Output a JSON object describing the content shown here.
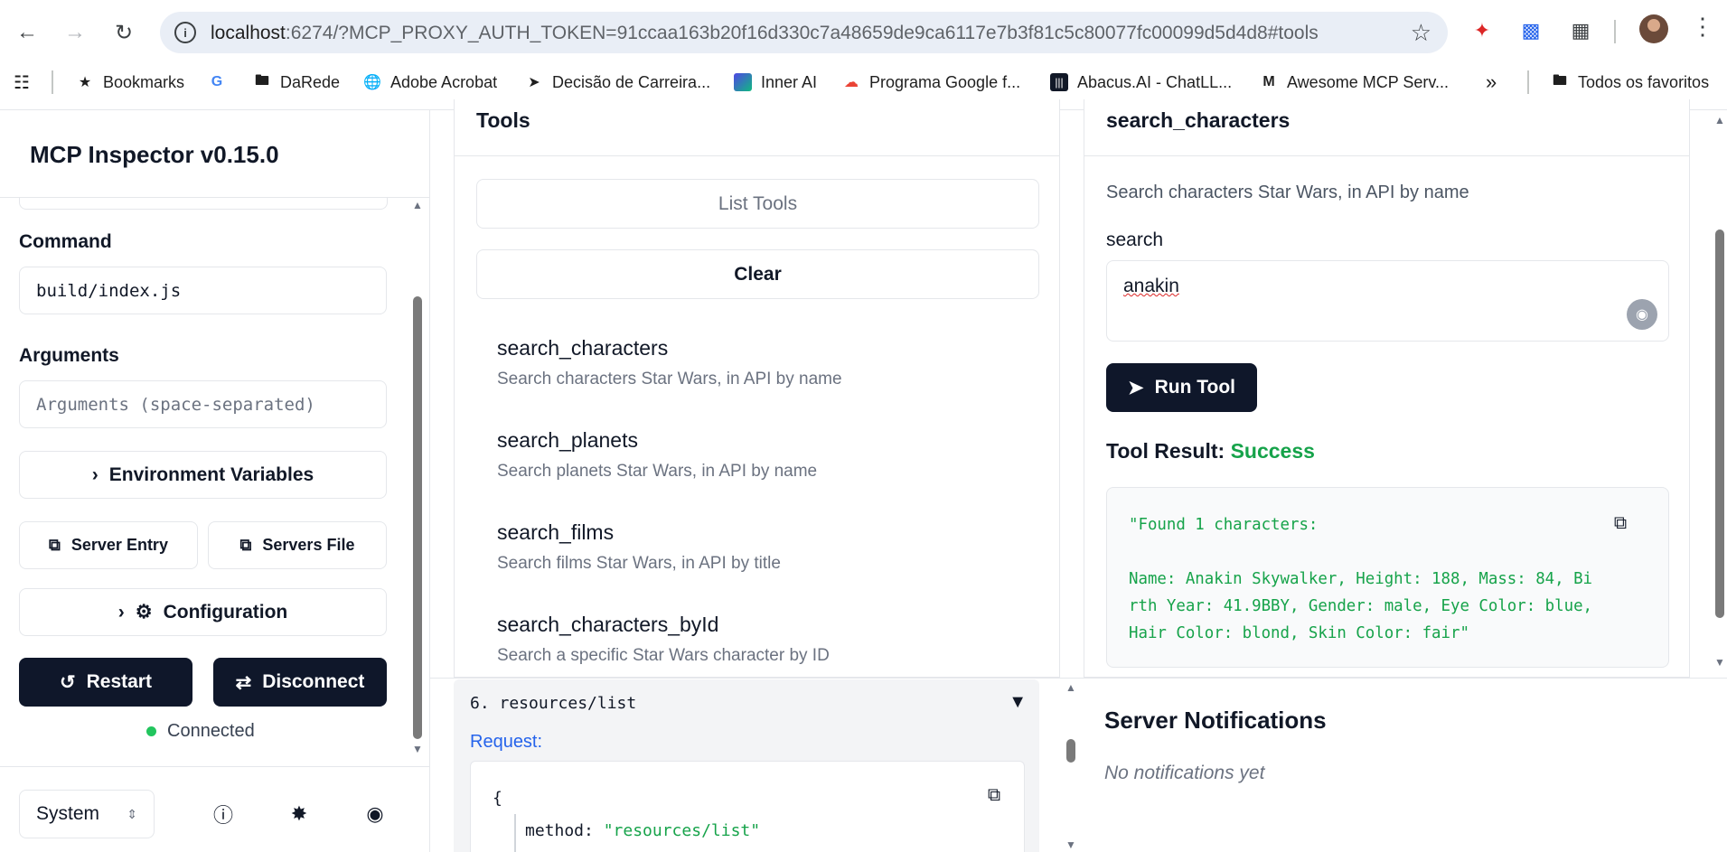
{
  "browser": {
    "url_host": "localhost",
    "url_rest": ":6274/?MCP_PROXY_AUTH_TOKEN=91ccaa163b20f16d330c7a48659de9ca6117e7b3f81c5c80077fc00099d5d4d8#tools",
    "bookmarks": [
      {
        "label": "Bookmarks",
        "icon": "star-icon"
      },
      {
        "label": "",
        "icon": "google-icon"
      },
      {
        "label": "DaRede",
        "icon": "folder-icon"
      },
      {
        "label": "Adobe Acrobat",
        "icon": "globe-icon"
      },
      {
        "label": "Decisão de Carreira...",
        "icon": "bookmark-icon"
      },
      {
        "label": "Inner AI",
        "icon": "inner-ai-icon"
      },
      {
        "label": "Programa Google f...",
        "icon": "google-cloud-icon"
      },
      {
        "label": "Abacus.AI - ChatLL...",
        "icon": "abacus-icon"
      },
      {
        "label": "Awesome MCP Serv...",
        "icon": "mcp-icon"
      }
    ],
    "all_bookmarks_label": "Todos os favoritos"
  },
  "sidebar": {
    "title": "MCP Inspector v0.15.0",
    "command_label": "Command",
    "command_value": "build/index.js",
    "arguments_label": "Arguments",
    "arguments_placeholder": "Arguments (space-separated)",
    "env_vars_label": "Environment Variables",
    "server_entry_label": "Server Entry",
    "servers_file_label": "Servers File",
    "configuration_label": "Configuration",
    "restart_label": "Restart",
    "disconnect_label": "Disconnect",
    "status": "Connected",
    "theme_value": "System"
  },
  "tools": {
    "title": "Tools",
    "list_tools_label": "List Tools",
    "clear_label": "Clear",
    "items": [
      {
        "name": "search_characters",
        "desc": "Search characters Star Wars, in API by name"
      },
      {
        "name": "search_planets",
        "desc": "Search planets Star Wars, in API by name"
      },
      {
        "name": "search_films",
        "desc": "Search films Star Wars, in API by title"
      },
      {
        "name": "search_characters_byId",
        "desc": "Search a specific Star Wars character by ID"
      }
    ]
  },
  "detail": {
    "title": "search_characters",
    "description": "Search characters Star Wars, in API by name",
    "param_label": "search",
    "param_value": "anakin",
    "run_label": "Run Tool",
    "result_label": "Tool Result:",
    "result_status": "Success",
    "result_text": "\"Found 1 characters:\n\nName: Anakin Skywalker, Height: 188, Mass: 84, Bi\nrth Year: 41.9BBY, Gender: male, Eye Color: blue,\nHair Color: blond, Skin Color: fair\""
  },
  "history": {
    "title": "6. resources/list",
    "request_label": "Request:",
    "code_open": "{",
    "code_key": "method:",
    "code_value": "\"resources/list\""
  },
  "notifications": {
    "title": "Server Notifications",
    "empty": "No notifications yet"
  },
  "colors": {
    "accent_dark": "#0f172a",
    "success": "#16a34a",
    "status_dot": "#22c55e",
    "link_blue": "#2563eb"
  }
}
